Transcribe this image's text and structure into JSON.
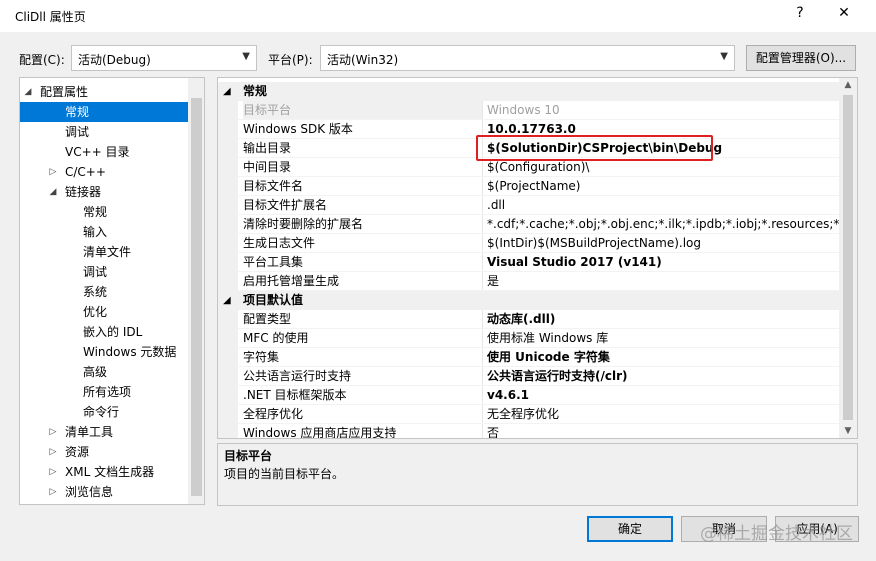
{
  "window": {
    "title": "CliDll 属性页",
    "help_icon": "?",
    "close_icon": "✕"
  },
  "toolbar": {
    "config_label": "配置(C):",
    "config_value": "活动(Debug)",
    "platform_label": "平台(P):",
    "platform_value": "活动(Win32)",
    "config_manager_label": "配置管理器(O)..."
  },
  "tree": {
    "items": [
      {
        "label": "配置属性",
        "expander": "◢"
      },
      {
        "label": "常规",
        "selected": true
      },
      {
        "label": "调试"
      },
      {
        "label": "VC++ 目录"
      },
      {
        "label": "C/C++",
        "expander": "▷"
      },
      {
        "label": "链接器",
        "expander": "◢"
      },
      {
        "label": "常规"
      },
      {
        "label": "输入"
      },
      {
        "label": "清单文件"
      },
      {
        "label": "调试"
      },
      {
        "label": "系统"
      },
      {
        "label": "优化"
      },
      {
        "label": "嵌入的 IDL"
      },
      {
        "label": "Windows 元数据"
      },
      {
        "label": "高级"
      },
      {
        "label": "所有选项"
      },
      {
        "label": "命令行"
      },
      {
        "label": "清单工具",
        "expander": "▷"
      },
      {
        "label": "资源",
        "expander": "▷"
      },
      {
        "label": "XML 文档生成器",
        "expander": "▷"
      },
      {
        "label": "浏览信息",
        "expander": "▷"
      }
    ]
  },
  "grid": {
    "rows": [
      {
        "kind": "category",
        "name": "常规",
        "expander": "◢"
      },
      {
        "name": "目标平台",
        "value": "Windows 10",
        "disabled": true,
        "selected": true
      },
      {
        "name": "Windows SDK 版本",
        "value": "10.0.17763.0",
        "bold": true
      },
      {
        "name": "输出目录",
        "value": "$(SolutionDir)CSProject\\bin\\Debug",
        "bold": true
      },
      {
        "name": "中间目录",
        "value": "$(Configuration)\\"
      },
      {
        "name": "目标文件名",
        "value": "$(ProjectName)"
      },
      {
        "name": "目标文件扩展名",
        "value": ".dll"
      },
      {
        "name": "清除时要删除的扩展名",
        "value": "*.cdf;*.cache;*.obj;*.obj.enc;*.ilk;*.ipdb;*.iobj;*.resources;*.tlb;*."
      },
      {
        "name": "生成日志文件",
        "value": "$(IntDir)$(MSBuildProjectName).log"
      },
      {
        "name": "平台工具集",
        "value": "Visual Studio 2017 (v141)",
        "bold": true
      },
      {
        "name": "启用托管增量生成",
        "value": "是"
      },
      {
        "kind": "category",
        "name": "项目默认值",
        "expander": "◢"
      },
      {
        "name": "配置类型",
        "value": "动态库(.dll)",
        "bold": true
      },
      {
        "name": "MFC 的使用",
        "value": "使用标准 Windows 库"
      },
      {
        "name": "字符集",
        "value": "使用 Unicode 字符集",
        "bold": true
      },
      {
        "name": "公共语言运行时支持",
        "value": "公共语言运行时支持(/clr)",
        "bold": true
      },
      {
        "name": ".NET 目标框架版本",
        "value": "v4.6.1",
        "bold": true
      },
      {
        "name": "全程序优化",
        "value": "无全程序优化"
      },
      {
        "name": "Windows 应用商店应用支持",
        "value": "否"
      }
    ]
  },
  "description": {
    "title": "目标平台",
    "text": "项目的当前目标平台。"
  },
  "buttons": {
    "ok": "确定",
    "cancel": "取消",
    "apply": "应用(A)"
  },
  "watermark": "@稀土掘金技术社区",
  "colors": {
    "selection": "#0078d7",
    "highlight_box": "#e02020"
  }
}
